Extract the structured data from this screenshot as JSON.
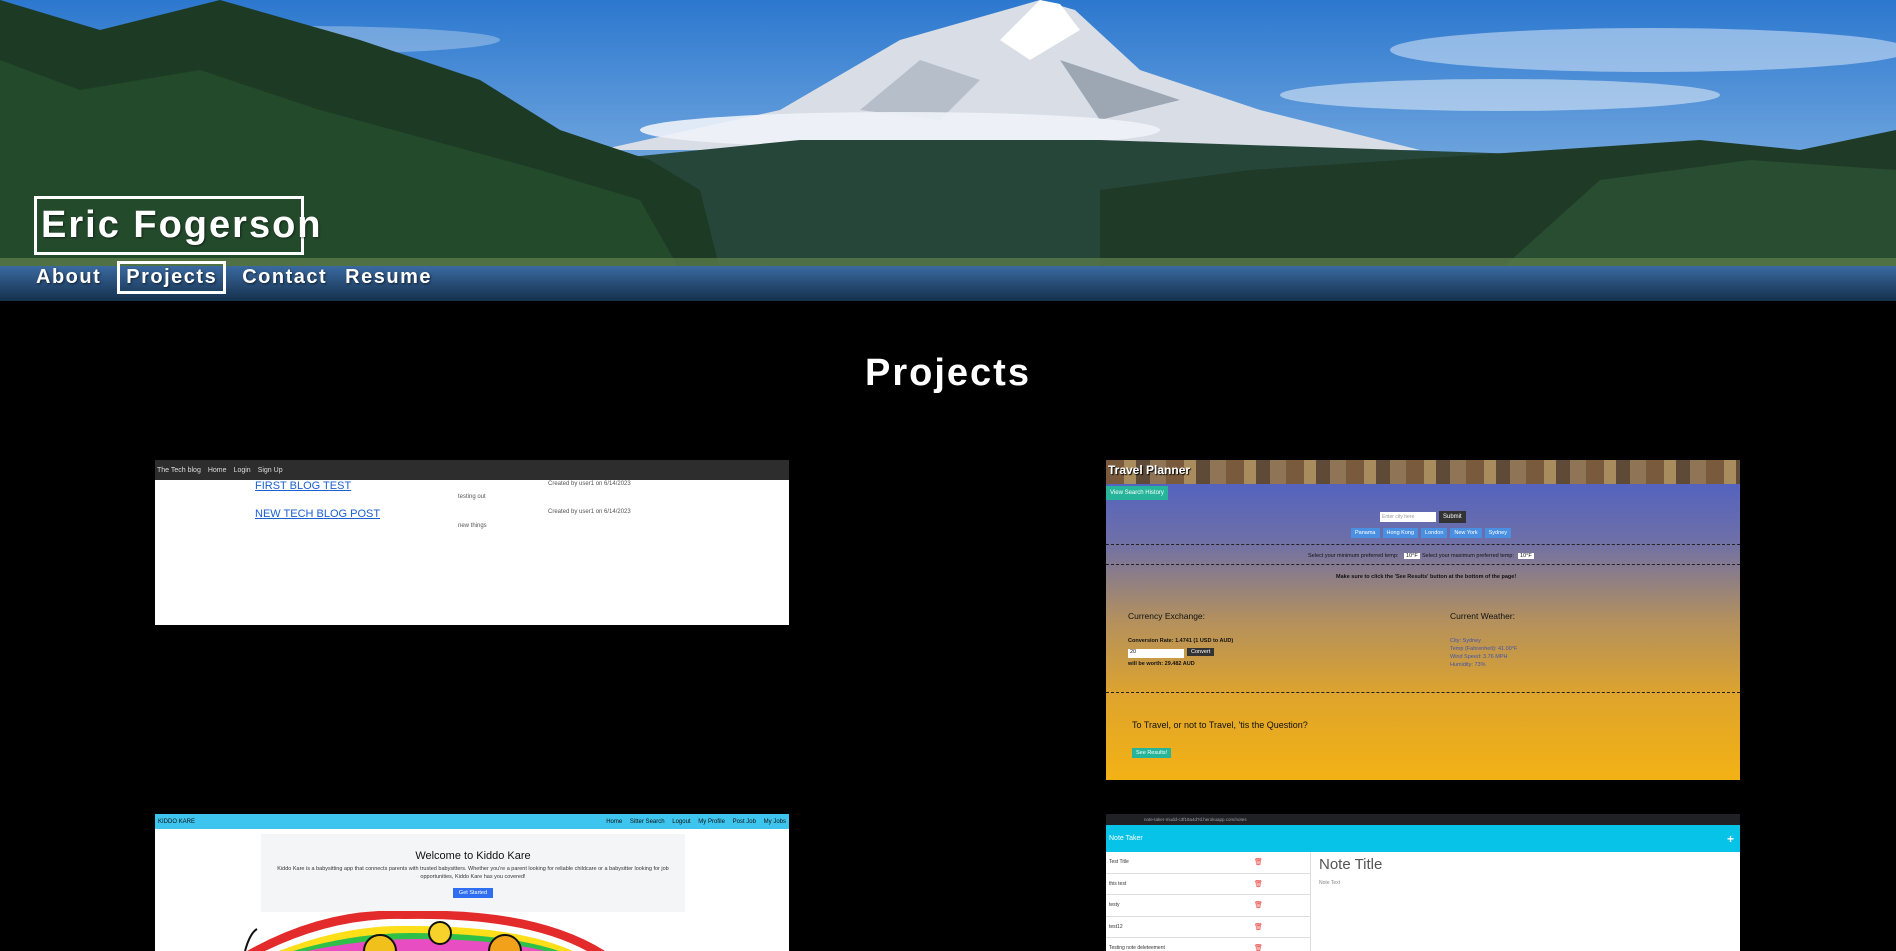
{
  "header": {
    "name": "Eric Fogerson",
    "nav": [
      "About",
      "Projects",
      "Contact",
      "Resume"
    ],
    "active_nav": "Projects"
  },
  "main": {
    "title": "Projects"
  },
  "projects": {
    "tech_blog": {
      "brand": "The Tech blog",
      "nav": [
        "Home",
        "Login",
        "Sign Up"
      ],
      "posts": [
        {
          "title": "FIRST BLOG TEST",
          "body": "testing out",
          "meta": "Created by user1 on 6/14/2023"
        },
        {
          "title": "NEW TECH BLOG POST",
          "body": "new things",
          "meta": "Created by user1 on 6/14/2023"
        }
      ]
    },
    "travel_planner": {
      "title": "Travel Planner",
      "history_button": "View Search History",
      "input_placeholder": "Enter city here",
      "submit": "Submit",
      "cities": [
        "Panama",
        "Hong Kong",
        "London",
        "New York",
        "Sydney"
      ],
      "temp_min_label": "Select your minimum preferred temp:",
      "temp_max_label": "Select your maximum preferred temp:",
      "temp_min_value": "10°F",
      "temp_max_value": "10°F",
      "note": "Make sure to click the 'See Results' button at the bottom of the page!",
      "currency_heading": "Currency Exchange:",
      "conversion_rate": "Conversion Rate: 1.4741 (1 USD to AUD)",
      "amount_value": "20",
      "convert_button": "Convert",
      "worth": "will be worth: 29.482 AUD",
      "weather_heading": "Current Weather:",
      "weather_lines": [
        "City: Sydney",
        "Temp (Fahrenheit): 41.00°F",
        "Wind Speed: 3.76 MPH",
        "Humidity: 73%"
      ],
      "question": "To Travel, or not to Travel, 'tis the Question?",
      "results_button": "See Results!"
    },
    "kiddo_kare": {
      "brand": "KIDDO KARE",
      "nav": [
        "Home",
        "Sitter Search",
        "Logout",
        "My Profile",
        "Post Job",
        "My Jobs"
      ],
      "welcome": "Welcome to Kiddo Kare",
      "description": "Kiddo Kare is a babysitting app that connects parents with trusted babysitters. Whether you're a parent looking for reliable childcare or a babysitter looking for job opportunities, Kiddo Kare has you covered!",
      "button": "Get Started"
    },
    "note_taker": {
      "url": "note-taker-mudd-c3f18a4d7d.herokuapp.com/notes",
      "title": "Note Taker",
      "notes": [
        "Test Title",
        "this test",
        "testy",
        "test12",
        "Testing note deleteement"
      ],
      "editor_title": "Note Title",
      "editor_text": "Note Text"
    }
  },
  "colors": {
    "page_bg": "#000000",
    "note_taker_header": "#08c3e8",
    "kiddo_nav": "#3ec5ef",
    "travel_button": "#26b59a"
  }
}
